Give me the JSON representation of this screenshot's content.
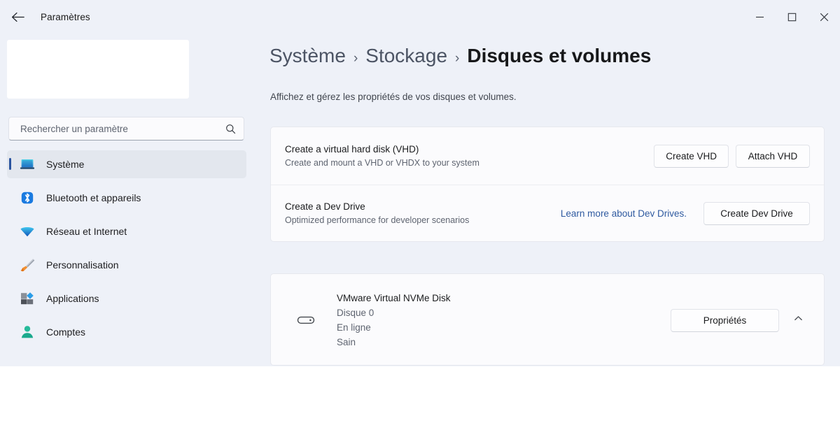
{
  "window": {
    "app_title": "Paramètres",
    "back_icon": "arrow-left-icon",
    "controls": {
      "minimize": "minimize-icon",
      "maximize": "maximize-icon",
      "close": "close-icon"
    }
  },
  "sidebar": {
    "search": {
      "placeholder": "Rechercher un paramètre",
      "value": "",
      "icon": "search-icon"
    },
    "items": [
      {
        "label": "Système",
        "icon": "system-laptop-icon",
        "selected": true
      },
      {
        "label": "Bluetooth et appareils",
        "icon": "bluetooth-icon",
        "selected": false
      },
      {
        "label": "Réseau et Internet",
        "icon": "wifi-icon",
        "selected": false
      },
      {
        "label": "Personnalisation",
        "icon": "paintbrush-icon",
        "selected": false
      },
      {
        "label": "Applications",
        "icon": "apps-icon",
        "selected": false
      },
      {
        "label": "Comptes",
        "icon": "person-icon",
        "selected": false
      }
    ]
  },
  "main": {
    "breadcrumb": {
      "crumb1": "Système",
      "crumb2": "Stockage",
      "crumb3": "Disques et volumes",
      "separator": "›"
    },
    "subtitle": "Affichez et gérez les propriétés de vos disques et volumes.",
    "vhd_row": {
      "title": "Create a virtual hard disk (VHD)",
      "subtitle": "Create and mount a VHD or VHDX to your system",
      "create_button": "Create VHD",
      "attach_button": "Attach VHD"
    },
    "devdrive_row": {
      "title": "Create a Dev Drive",
      "subtitle": "Optimized performance for developer scenarios",
      "link": "Learn more about Dev Drives.",
      "create_button": "Create Dev Drive"
    },
    "disk": {
      "icon": "hard-drive-icon",
      "name": "VMware Virtual NVMe Disk",
      "number": "Disque 0",
      "state": "En ligne",
      "health": "Sain",
      "properties_button": "Propriétés",
      "expander_icon": "chevron-up-icon"
    }
  },
  "colors": {
    "page_background": "#eef1f8",
    "card_background": "#fbfbfd",
    "accent": "#2a54a0",
    "link": "#2f5aa0",
    "text_primary": "#1a1b1d",
    "text_secondary": "#5e6470"
  }
}
